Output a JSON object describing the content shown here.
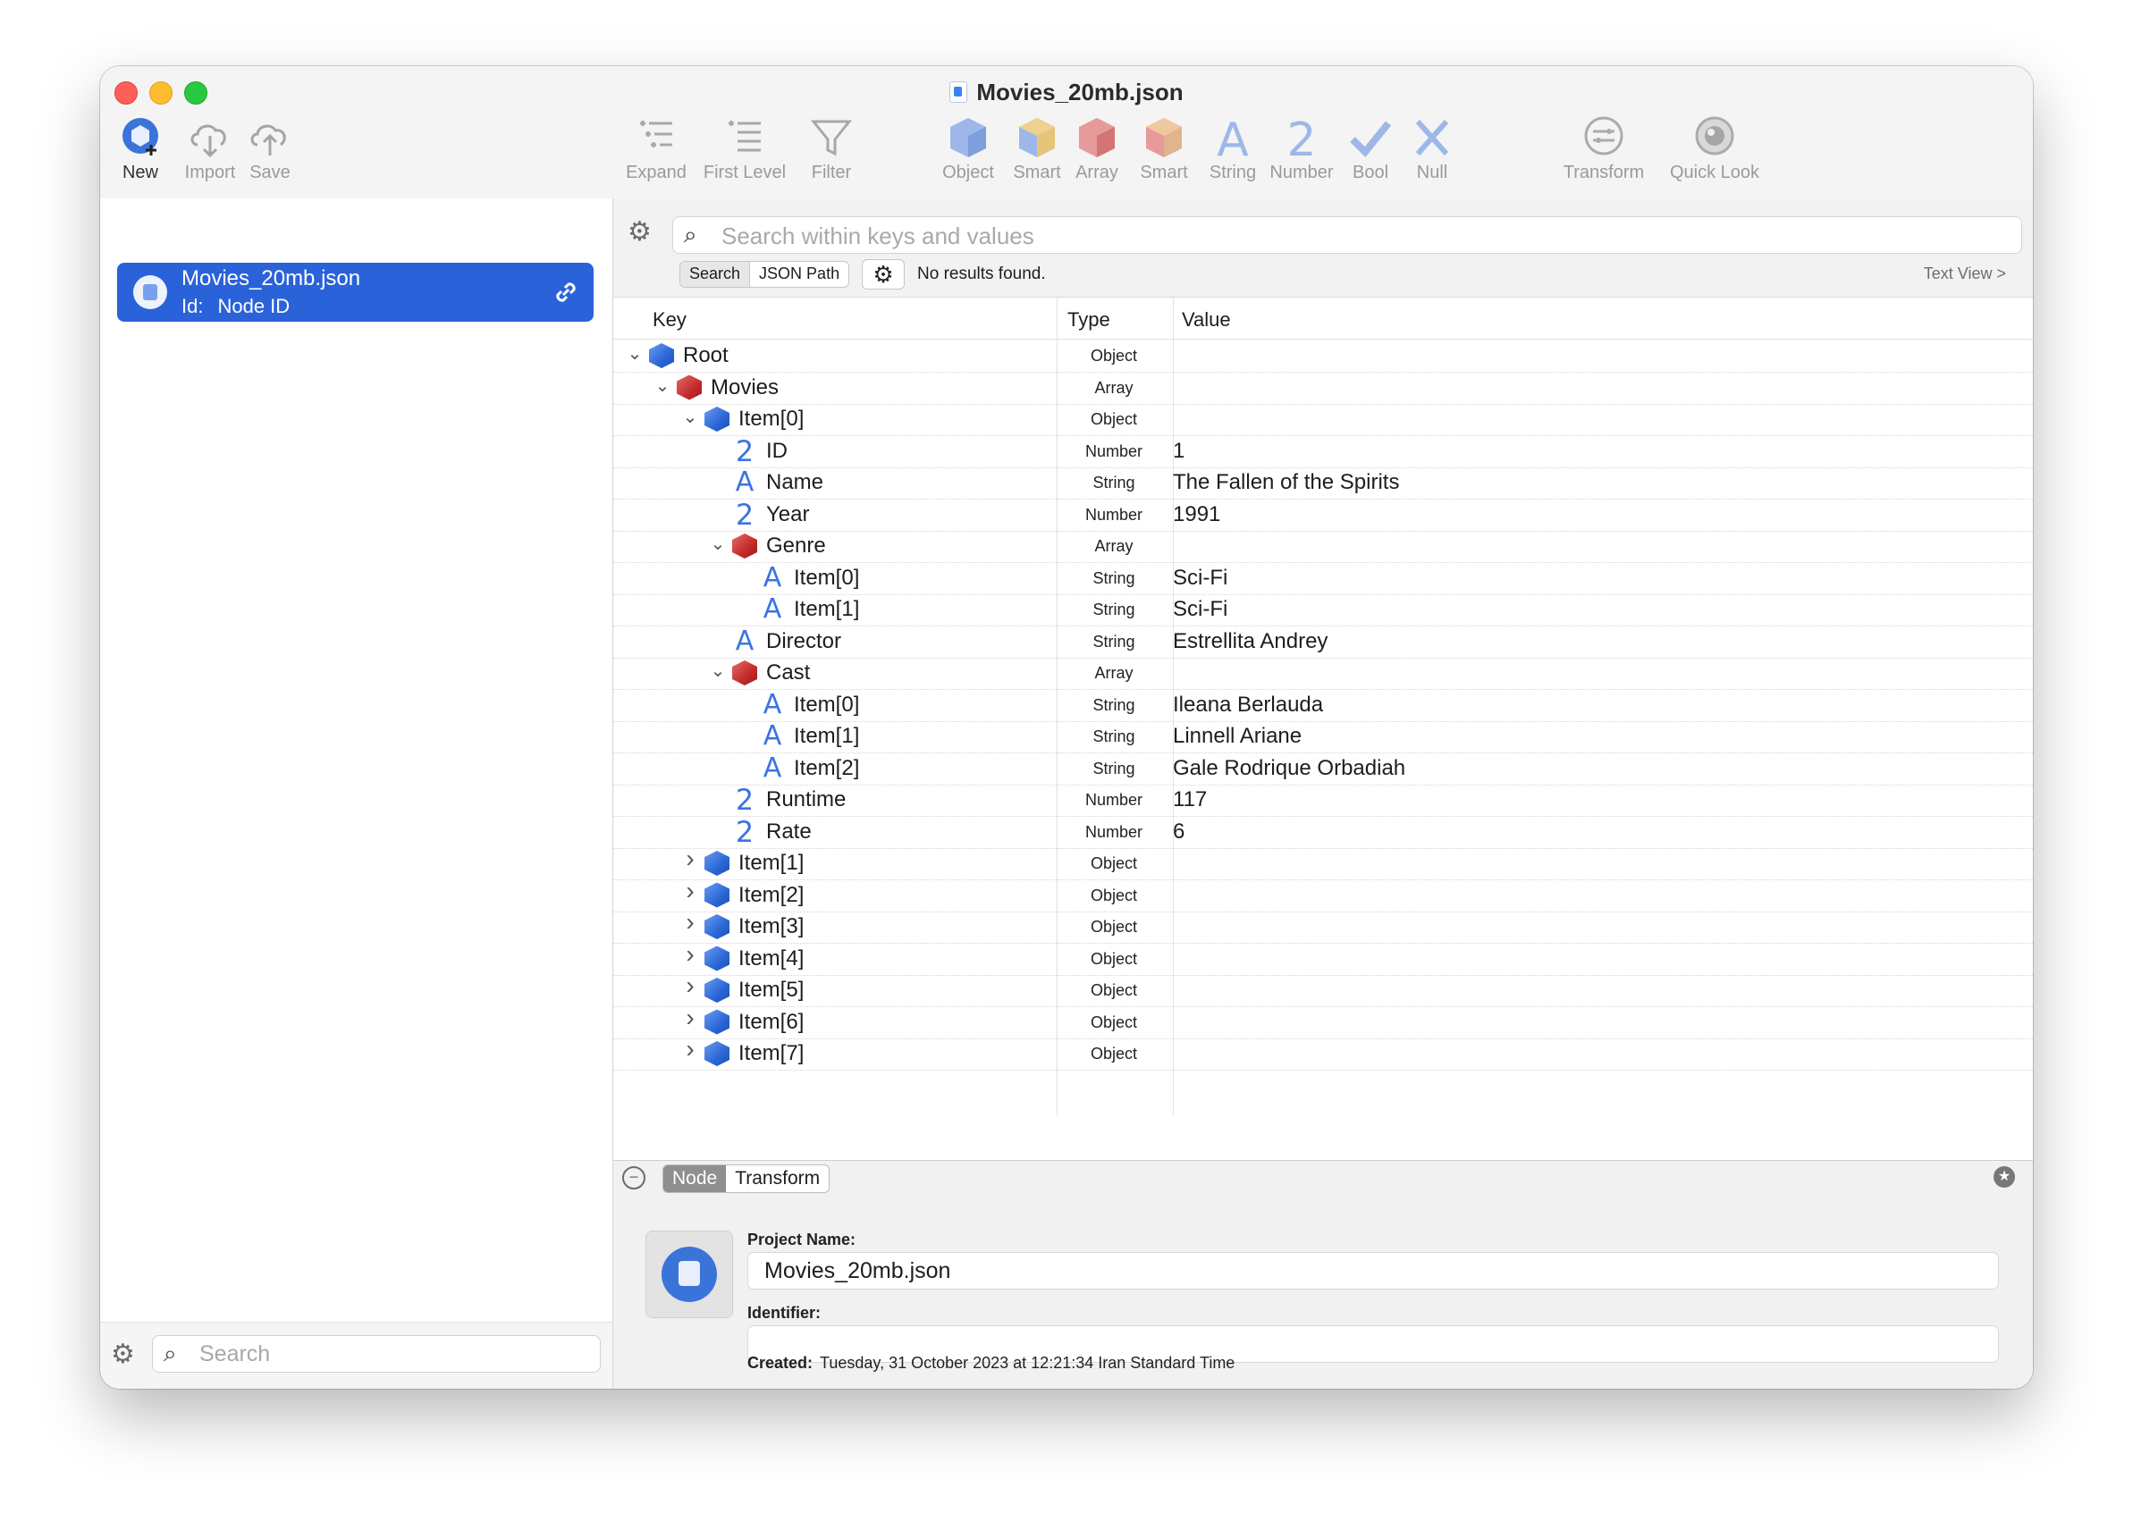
{
  "window": {
    "title": "Movies_20mb.json"
  },
  "toolbar": {
    "new": "New",
    "import": "Import",
    "save": "Save",
    "expand": "Expand",
    "first_level": "First Level",
    "filter": "Filter",
    "object": "Object",
    "smart1": "Smart",
    "array": "Array",
    "smart2": "Smart",
    "string": "String",
    "number": "Number",
    "bool": "Bool",
    "null": "Null",
    "transform": "Transform",
    "quick_look": "Quick Look"
  },
  "sidebar": {
    "item": {
      "title": "Movies_20mb.json",
      "id_key": "Id:",
      "id_value": "Node ID"
    },
    "search_placeholder": "Search"
  },
  "search": {
    "placeholder": "Search within keys and values",
    "mode_search": "Search",
    "mode_jsonpath": "JSON Path",
    "status": "No results found.",
    "text_view": "Text View >"
  },
  "table": {
    "headers": {
      "key": "Key",
      "type": "Type",
      "value": "Value"
    },
    "rows": [
      {
        "key": "Root",
        "type": "Object",
        "value": ""
      },
      {
        "key": "Movies",
        "type": "Array",
        "value": ""
      },
      {
        "key": "Item[0]",
        "type": "Object",
        "value": ""
      },
      {
        "key": "ID",
        "type": "Number",
        "value": "1"
      },
      {
        "key": "Name",
        "type": "String",
        "value": "The Fallen of the Spirits"
      },
      {
        "key": "Year",
        "type": "Number",
        "value": "1991"
      },
      {
        "key": "Genre",
        "type": "Array",
        "value": ""
      },
      {
        "key": "Item[0]",
        "type": "String",
        "value": "Sci-Fi"
      },
      {
        "key": "Item[1]",
        "type": "String",
        "value": "Sci-Fi"
      },
      {
        "key": "Director",
        "type": "String",
        "value": "Estrellita Andrey"
      },
      {
        "key": "Cast",
        "type": "Array",
        "value": ""
      },
      {
        "key": "Item[0]",
        "type": "String",
        "value": "Ileana Berlauda"
      },
      {
        "key": "Item[1]",
        "type": "String",
        "value": "Linnell Ariane"
      },
      {
        "key": "Item[2]",
        "type": "String",
        "value": "Gale Rodrique Orbadiah"
      },
      {
        "key": "Runtime",
        "type": "Number",
        "value": "117"
      },
      {
        "key": "Rate",
        "type": "Number",
        "value": "6"
      },
      {
        "key": "Item[1]",
        "type": "Object",
        "value": ""
      },
      {
        "key": "Item[2]",
        "type": "Object",
        "value": ""
      },
      {
        "key": "Item[3]",
        "type": "Object",
        "value": ""
      },
      {
        "key": "Item[4]",
        "type": "Object",
        "value": ""
      },
      {
        "key": "Item[5]",
        "type": "Object",
        "value": ""
      },
      {
        "key": "Item[6]",
        "type": "Object",
        "value": ""
      },
      {
        "key": "Item[7]",
        "type": "Object",
        "value": ""
      }
    ]
  },
  "inspector": {
    "tab_node": "Node",
    "tab_transform": "Transform",
    "project_name_label": "Project Name:",
    "project_name_value": "Movies_20mb.json",
    "identifier_label": "Identifier:",
    "identifier_value": "",
    "created_label": "Created:",
    "created_value": "Tuesday, 31 October 2023 at 12:21:34 Iran Standard Time"
  }
}
